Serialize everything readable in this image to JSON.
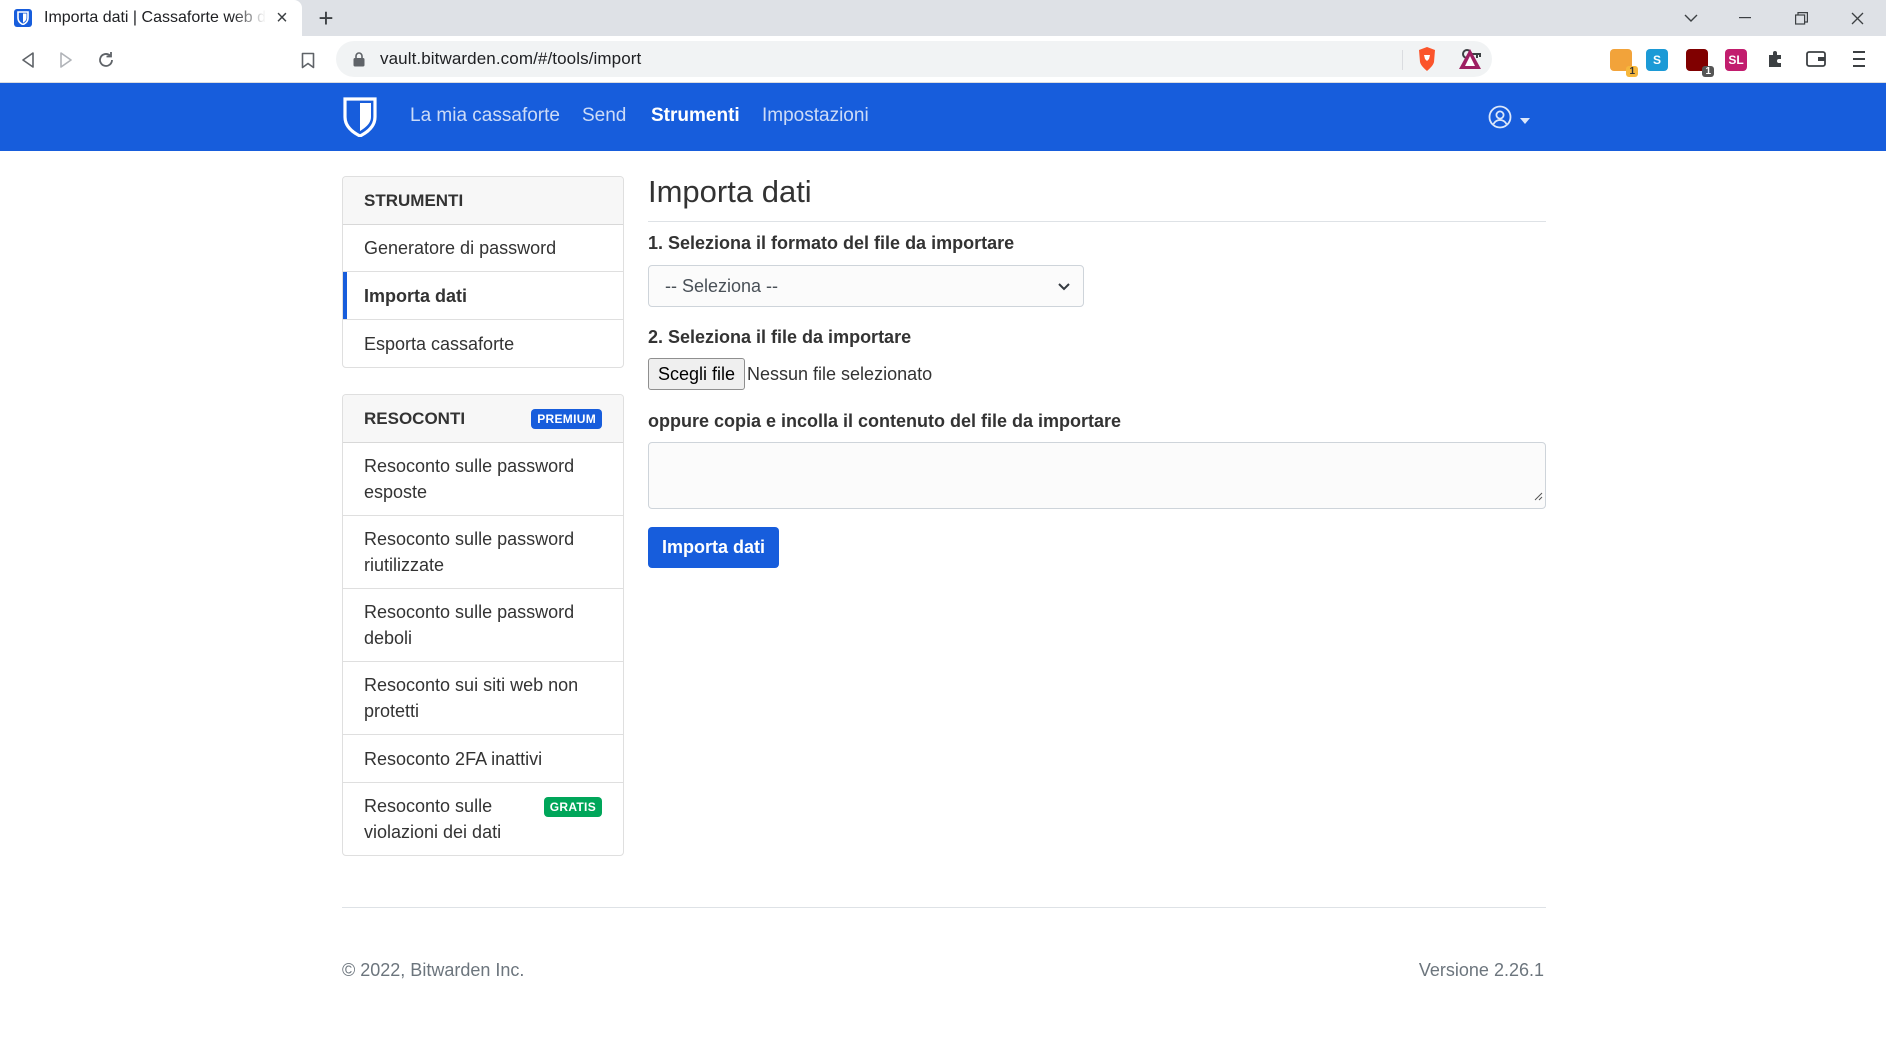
{
  "browser": {
    "tab_title": "Importa dati | Cassaforte web di Bitwarden",
    "url": "vault.bitwarden.com/#/tools/import",
    "icons": [
      "bitwarden-favicon",
      "close-icon",
      "plus-icon",
      "chevron-down-icon",
      "minimize-icon",
      "restore-icon",
      "close-window-icon",
      "back-icon",
      "forward-icon",
      "reload-icon",
      "bookmark-icon",
      "lock-icon",
      "key-icon",
      "brave-shields-icon",
      "brave-rewards-icon",
      "extensions-icon",
      "wallet-icon",
      "menu-icon"
    ],
    "extension_badges": [
      "1",
      "1"
    ],
    "ext_labels": {
      "s": "S",
      "sl": "SL"
    }
  },
  "navbar": {
    "links": [
      "La mia cassaforte",
      "Send",
      "Strumenti",
      "Impostazioni"
    ],
    "active_index": 2,
    "brand_color": "#175ddc"
  },
  "sidebar": {
    "tools_header": "STRUMENTI",
    "tools_items": [
      "Generatore di password",
      "Importa dati",
      "Esporta cassaforte"
    ],
    "tools_active_index": 1,
    "reports_header": "RESOCONTI",
    "reports_badge": "PREMIUM",
    "reports_items": [
      "Resoconto sulle password esposte",
      "Resoconto sulle password riutilizzate",
      "Resoconto sulle password deboli",
      "Resoconto sui siti web non protetti",
      "Resoconto 2FA inattivi",
      "Resoconto sulle violazioni dei dati"
    ],
    "reports_last_badge": "GRATIS"
  },
  "main": {
    "title": "Importa dati",
    "step1_label": "1. Seleziona il formato del file da importare",
    "select_value": "-- Seleziona --",
    "step2_label": "2. Seleziona il file da importare",
    "file_button": "Scegli file",
    "file_status": "Nessun file selezionato",
    "paste_label": "oppure copia e incolla il contenuto del file da importare",
    "submit_label": "Importa dati"
  },
  "footer": {
    "copyright": "© 2022, Bitwarden Inc.",
    "version": "Versione 2.26.1"
  }
}
